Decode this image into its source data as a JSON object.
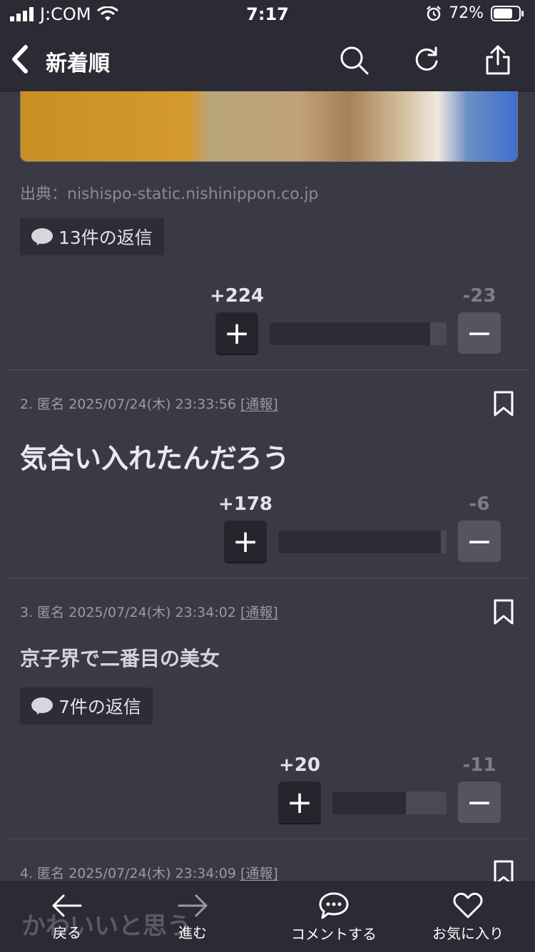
{
  "status": {
    "carrier": "J:COM",
    "time": "7:17",
    "battery": "72%"
  },
  "nav": {
    "title": "新着順"
  },
  "post1": {
    "source": "出典：nishispo-static.nishinippon.co.jp",
    "replies": "13件の返信",
    "plus": "+224",
    "minus": "-23",
    "ratio": 0.907
  },
  "post2": {
    "meta_prefix": "2. 匿名 2025/07/24(木) 23:33:56 ",
    "report": "[通報]",
    "text": "気合い入れたんだろう",
    "plus": "+178",
    "minus": "-6",
    "ratio": 0.967
  },
  "post3": {
    "meta_prefix": "3. 匿名 2025/07/24(木) 23:34:02 ",
    "report": "[通報]",
    "text": "京子界で二番目の美女",
    "replies": "7件の返信",
    "plus": "+20",
    "minus": "-11",
    "ratio": 0.645
  },
  "post4": {
    "meta_prefix": "4. 匿名 2025/07/24(木) 23:34:09 ",
    "report": "[通報]",
    "text_partial": "かわいいと思う"
  },
  "tabbar": {
    "back": "戻る",
    "forward": "進む",
    "comment": "コメントする",
    "favorite": "お気に入り"
  },
  "colors": {
    "background": "#3a3a47",
    "bar_bg": "#2b2b35"
  }
}
